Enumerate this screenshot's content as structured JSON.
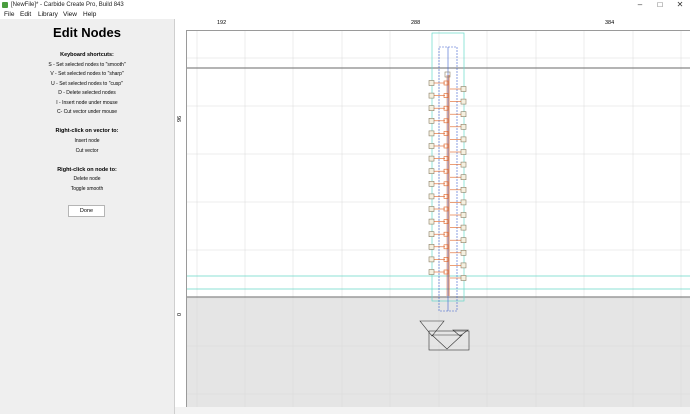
{
  "window": {
    "title": "[NewFile]* - Carbide Create Pro, Build 843",
    "minimize_glyph": "–",
    "maximize_glyph": "□",
    "close_glyph": "✕"
  },
  "menu": [
    "File",
    "Edit",
    "Library",
    "View",
    "Help"
  ],
  "panel": {
    "title": "Edit Nodes",
    "shortcuts_heading": "Keyboard shortcuts:",
    "shortcuts": [
      "S - Set selected nodes to \"smooth\"",
      "V - Set selected nodes to \"sharp\"",
      "U - Set selected nodes to \"cusp\"",
      "D - Delete selected nodes",
      "I - Insert node under mouse",
      "C- Cut vector under mouse"
    ],
    "vector_heading": "Right-click on vector to:",
    "vector_actions": [
      "Insert node",
      "Cut vector"
    ],
    "node_heading": "Right-click on node to:",
    "node_actions": [
      "Delete node",
      "Toggle smooth"
    ],
    "done_label": "Done"
  },
  "rulers": {
    "horizontal": [
      "192",
      "288",
      "384"
    ],
    "vertical": [
      "96",
      "0"
    ]
  },
  "colors": {
    "panel_bg": "#efefef",
    "canvas_bg": "#ffffff",
    "grid": "#dadada",
    "stock_outline": "#6a6a6a",
    "toolpath": "#66d9c9",
    "selection": "#3a5fcd",
    "node_handle": "#e06020",
    "node_box": "#8a7f65",
    "origin_marker": "#e04040"
  }
}
